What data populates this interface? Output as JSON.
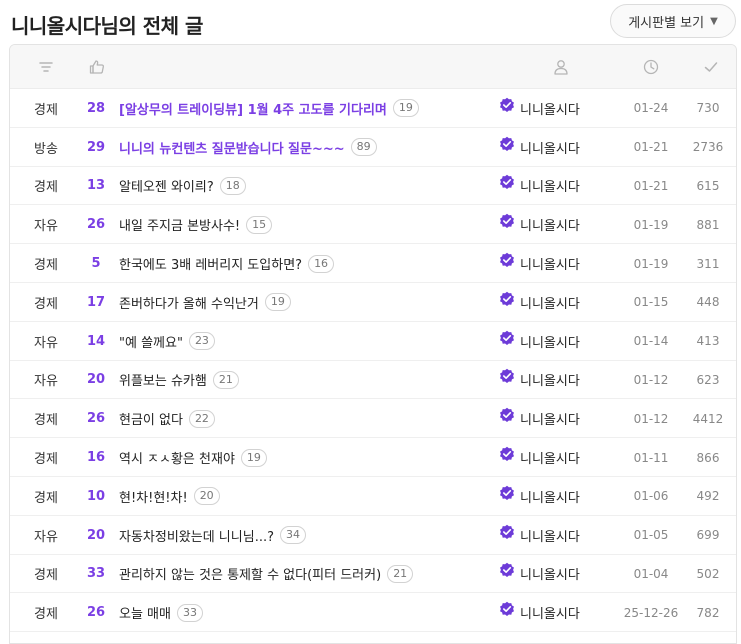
{
  "page": {
    "title": "니니올시다님의 전체 글",
    "board_select_label": "게시판별 보기",
    "board_select_caret": "▼"
  },
  "table_header": {
    "icons": [
      "filter-icon",
      "thumbs-up-icon",
      "person-icon",
      "clock-icon",
      "check-icon"
    ]
  },
  "colors": {
    "accent": "#7b3fe4",
    "badge": "#6d3bd8"
  },
  "rows": [
    {
      "category": "경제",
      "likes": "28",
      "title": "[알상무의 트레이딩뷰] 1월 4주 고도를 기다리며",
      "hot": true,
      "comments": "19",
      "author": "니니올시다",
      "date": "01-24",
      "views": "730"
    },
    {
      "category": "방송",
      "likes": "29",
      "title": "니니의 뉴컨텐츠 질문받습니다 질문~~~",
      "hot": true,
      "comments": "89",
      "author": "니니올시다",
      "date": "01-21",
      "views": "2736"
    },
    {
      "category": "경제",
      "likes": "13",
      "title": "알테오젠 와이릐?",
      "hot": false,
      "comments": "18",
      "author": "니니올시다",
      "date": "01-21",
      "views": "615"
    },
    {
      "category": "자유",
      "likes": "26",
      "title": "내일 주지금 본방사수!",
      "hot": false,
      "comments": "15",
      "author": "니니올시다",
      "date": "01-19",
      "views": "881"
    },
    {
      "category": "경제",
      "likes": "5",
      "title": "한국에도 3배 레버리지 도입하면?",
      "hot": false,
      "comments": "16",
      "author": "니니올시다",
      "date": "01-19",
      "views": "311"
    },
    {
      "category": "경제",
      "likes": "17",
      "title": "존버하다가 올해 수익난거",
      "hot": false,
      "comments": "19",
      "author": "니니올시다",
      "date": "01-15",
      "views": "448"
    },
    {
      "category": "자유",
      "likes": "14",
      "title": "\"예 쓸께요\"",
      "hot": false,
      "comments": "23",
      "author": "니니올시다",
      "date": "01-14",
      "views": "413"
    },
    {
      "category": "자유",
      "likes": "20",
      "title": "위플보는 슈카햄",
      "hot": false,
      "comments": "21",
      "author": "니니올시다",
      "date": "01-12",
      "views": "623"
    },
    {
      "category": "경제",
      "likes": "26",
      "title": "현금이 없다",
      "hot": false,
      "comments": "22",
      "author": "니니올시다",
      "date": "01-12",
      "views": "4412"
    },
    {
      "category": "경제",
      "likes": "16",
      "title": "역시 ㅈㅅ황은 천재야",
      "hot": false,
      "comments": "19",
      "author": "니니올시다",
      "date": "01-11",
      "views": "866"
    },
    {
      "category": "경제",
      "likes": "10",
      "title": "현!차!현!차!",
      "hot": false,
      "comments": "20",
      "author": "니니올시다",
      "date": "01-06",
      "views": "492"
    },
    {
      "category": "자유",
      "likes": "20",
      "title": "자동차정비왔는데 니니님...?",
      "hot": false,
      "comments": "34",
      "author": "니니올시다",
      "date": "01-05",
      "views": "699"
    },
    {
      "category": "경제",
      "likes": "33",
      "title": "관리하지 않는 것은 통제할 수 없다(피터 드러커)",
      "hot": false,
      "comments": "21",
      "author": "니니올시다",
      "date": "01-04",
      "views": "502"
    },
    {
      "category": "경제",
      "likes": "26",
      "title": "오늘 매매",
      "hot": false,
      "comments": "33",
      "author": "니니올시다",
      "date": "25-12-26",
      "views": "782"
    }
  ]
}
